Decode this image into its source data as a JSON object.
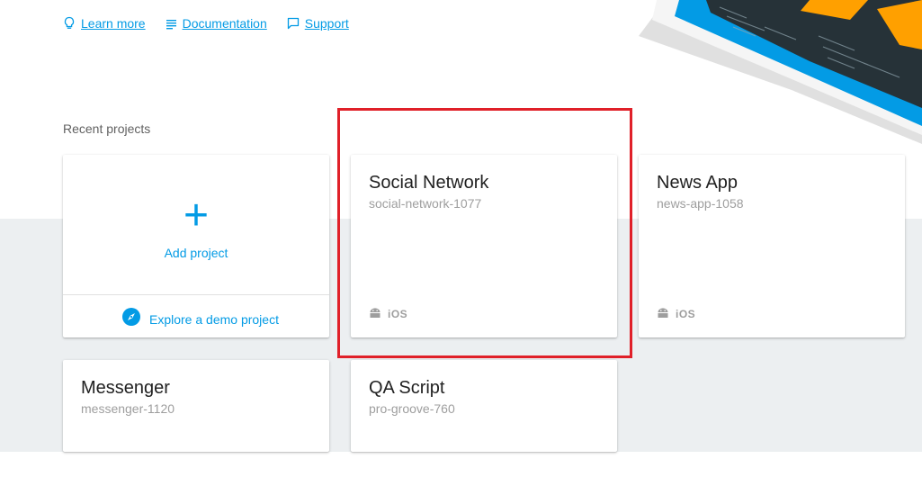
{
  "top_links": [
    {
      "label": "Learn more",
      "icon": "lightbulb-icon"
    },
    {
      "label": "Documentation",
      "icon": "document-lines-icon"
    },
    {
      "label": "Support",
      "icon": "chat-bubble-icon"
    }
  ],
  "recent_projects_label": "Recent projects",
  "add_card": {
    "plus_symbol": "+",
    "add_label": "Add project",
    "demo_label": "Explore a demo project",
    "demo_icon": "compass-icon"
  },
  "projects": [
    {
      "name": "Social Network",
      "id": "social-network-1077",
      "platform": "iOS"
    },
    {
      "name": "News App",
      "id": "news-app-1058",
      "platform": "iOS"
    },
    {
      "name": "Messenger",
      "id": "messenger-1120"
    },
    {
      "name": "QA Script",
      "id": "pro-groove-760"
    }
  ],
  "colors": {
    "accent": "#039be5",
    "highlight": "#e02029",
    "lower_bg": "#eceff1"
  }
}
